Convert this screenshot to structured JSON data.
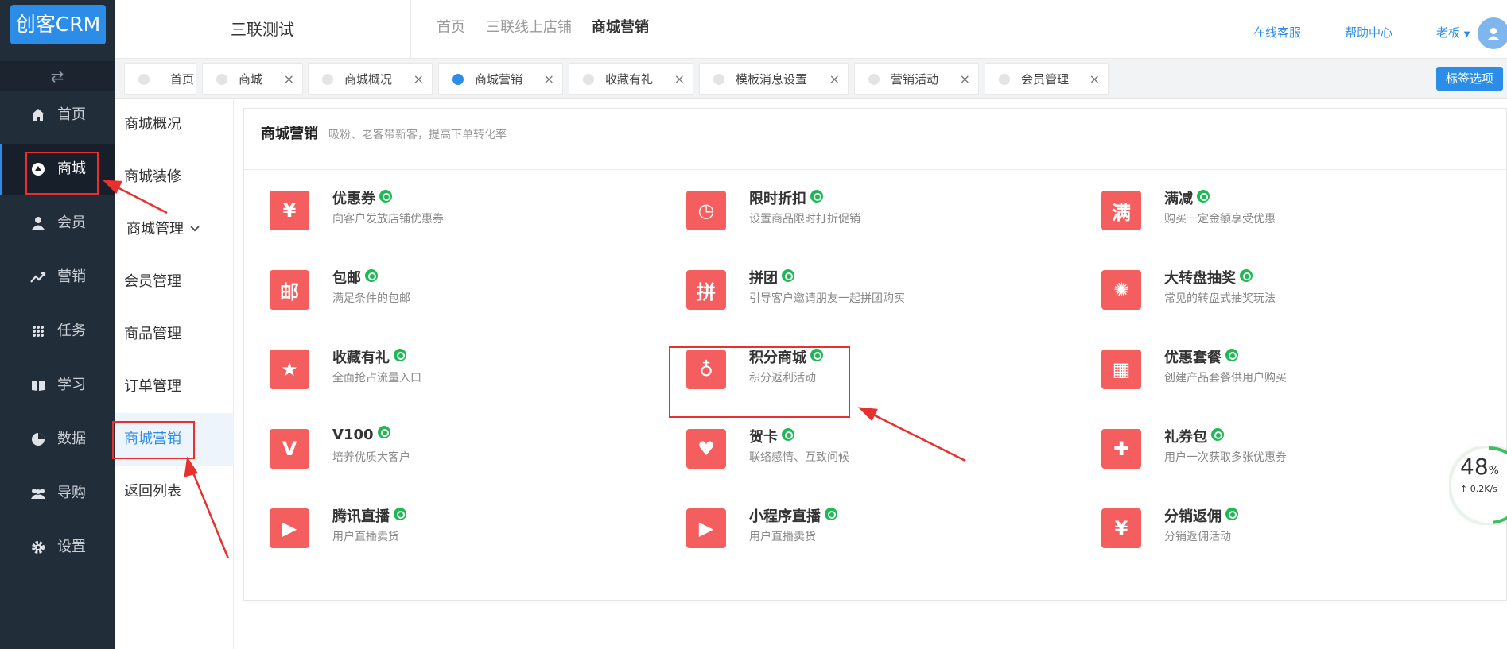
{
  "brand": "创客CRM",
  "nav": {
    "toggle_icon": "swap-icon",
    "items": [
      {
        "label": "首页",
        "icon": "home-icon"
      },
      {
        "label": "商城",
        "icon": "mall-icon"
      },
      {
        "label": "会员",
        "icon": "user-icon"
      },
      {
        "label": "营销",
        "icon": "trend-icon"
      },
      {
        "label": "任务",
        "icon": "grid-icon"
      },
      {
        "label": "学习",
        "icon": "book-icon"
      },
      {
        "label": "数据",
        "icon": "pie-icon"
      },
      {
        "label": "导购",
        "icon": "group-icon"
      },
      {
        "label": "设置",
        "icon": "gear-icon"
      }
    ],
    "active": "商城"
  },
  "header": {
    "store_name": "三联测试",
    "breadcrumbs": [
      "首页",
      "三联线上店铺",
      "商城营销"
    ],
    "links": [
      "在线客服",
      "帮助中心"
    ],
    "user": "老板"
  },
  "tabs": [
    {
      "label": "首页",
      "closable": false
    },
    {
      "label": "商城",
      "closable": true
    },
    {
      "label": "商城概况",
      "closable": true
    },
    {
      "label": "商城营销",
      "closable": true,
      "active": true
    },
    {
      "label": "收藏有礼",
      "closable": true
    },
    {
      "label": "模板消息设置",
      "closable": true
    },
    {
      "label": "营销活动",
      "closable": true
    },
    {
      "label": "会员管理",
      "closable": true
    }
  ],
  "tab_close_glyph": "×",
  "tag_options_button": "标签选项",
  "submenu": {
    "items": [
      "商城概况",
      "商城装修",
      "商城管理",
      "会员管理",
      "商品管理",
      "订单管理",
      "商城营销",
      "返回列表"
    ],
    "active": "商城营销"
  },
  "panel": {
    "title": "商城营销",
    "subtitle": "吸粉、老客带新客，提高下单转化率",
    "features": [
      {
        "title": "优惠券",
        "desc": "向客户发放店铺优惠券",
        "icon": "coupon-icon",
        "glyph": "¥"
      },
      {
        "title": "限时折扣",
        "desc": "设置商品限时打折促销",
        "icon": "clock-icon",
        "glyph": "◷"
      },
      {
        "title": "满减",
        "desc": "购买一定金额享受优惠",
        "icon": "discount-icon",
        "glyph": "满"
      },
      {
        "title": "包邮",
        "desc": "满足条件的包邮",
        "icon": "mail-icon",
        "glyph": "邮"
      },
      {
        "title": "拼团",
        "desc": "引导客户邀请朋友一起拼团购买",
        "icon": "group-buy-icon",
        "glyph": "拼"
      },
      {
        "title": "大转盘抽奖",
        "desc": "常见的转盘式抽奖玩法",
        "icon": "wheel-icon",
        "glyph": "✺"
      },
      {
        "title": "收藏有礼",
        "desc": "全面抢占流量入口",
        "icon": "star-icon",
        "glyph": "★"
      },
      {
        "title": "积分商城",
        "desc": "积分返利活动",
        "icon": "points-icon",
        "glyph": "♁"
      },
      {
        "title": "优惠套餐",
        "desc": "创建产品套餐供用户购买",
        "icon": "bundle-icon",
        "glyph": "▦"
      },
      {
        "title": "V100",
        "desc": "培养优质大客户",
        "icon": "v100-icon",
        "glyph": "V"
      },
      {
        "title": "贺卡",
        "desc": "联络感情、互致问候",
        "icon": "card-icon",
        "glyph": "♥"
      },
      {
        "title": "礼券包",
        "desc": "用户一次获取多张优惠券",
        "icon": "gift-icon",
        "glyph": "✚"
      },
      {
        "title": "腾讯直播",
        "desc": "用户直播卖货",
        "icon": "live-icon",
        "glyph": "▶"
      },
      {
        "title": "小程序直播",
        "desc": "用户直播卖货",
        "icon": "mini-live-icon",
        "glyph": "▶"
      },
      {
        "title": "分销返佣",
        "desc": "分销返佣活动",
        "icon": "commission-icon",
        "glyph": "¥"
      }
    ]
  },
  "speed_widget": {
    "percent": "48",
    "unit": "%",
    "rate": "↑ 0.2K/s"
  },
  "colors": {
    "nav_bg": "#222d3a",
    "accent": "#2b8de8",
    "feature_icon": "#f45e5e",
    "link_badge": "#1db954",
    "annotation": "#e8302f"
  }
}
